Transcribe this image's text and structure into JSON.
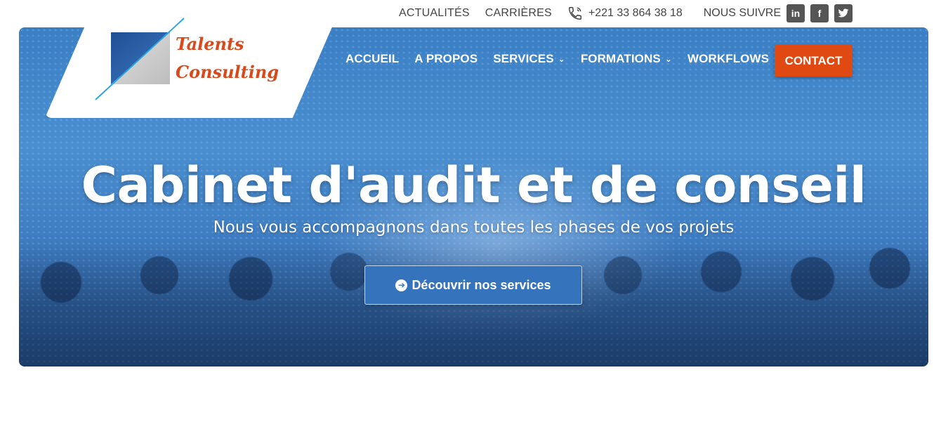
{
  "topbar": {
    "news": "ACTUALITÉS",
    "careers": "CARRIÈRES",
    "phone": "+221 33 864 38 18",
    "follow": "NOUS SUIVRE",
    "social": [
      {
        "name": "linkedin-icon",
        "glyph": "in"
      },
      {
        "name": "facebook-icon",
        "glyph": "f"
      },
      {
        "name": "twitter-icon",
        "glyph": "t"
      }
    ]
  },
  "logo": {
    "line1": "Talents",
    "line2": "Consulting"
  },
  "nav": {
    "home": "ACCUEIL",
    "about": "A PROPOS",
    "services": "SERVICES",
    "trainings": "FORMATIONS",
    "workflows": "WORKFLOWS",
    "contact": "CONTACT"
  },
  "hero": {
    "title": "Cabinet d'audit et de conseil",
    "subtitle": "Nous vous accompagnons dans toutes les phases de vos projets",
    "cta": "Découvrir nos services"
  },
  "colors": {
    "accent": "#e04a12",
    "hero_blue": "#3a7fc4",
    "button_blue": "#3574bd"
  }
}
